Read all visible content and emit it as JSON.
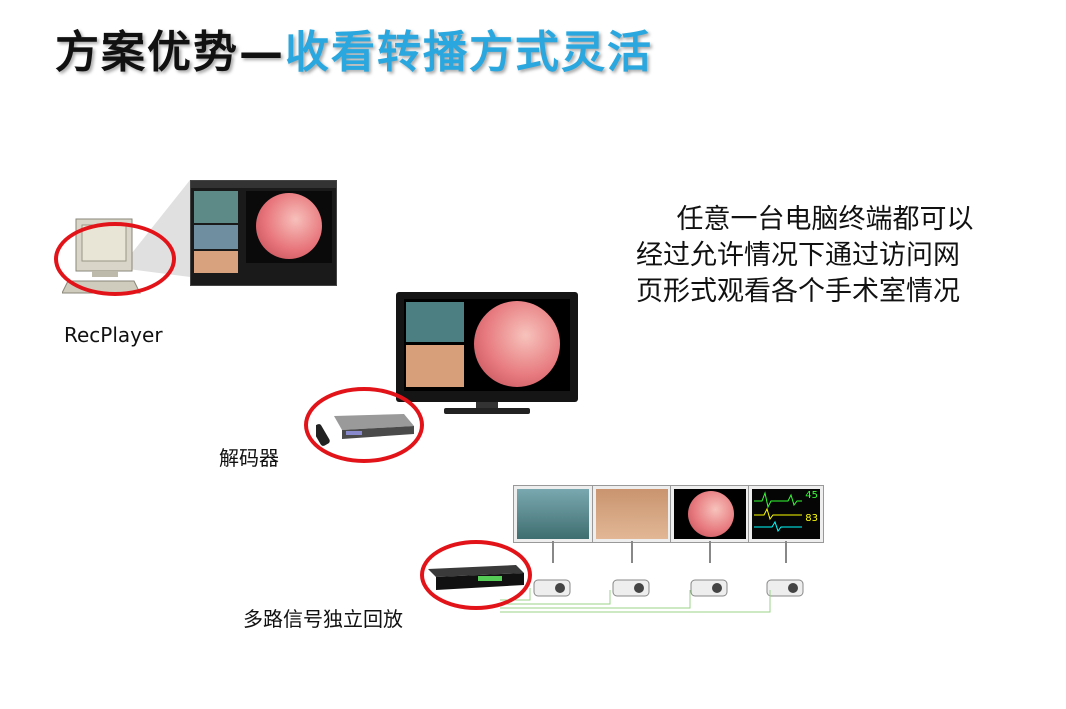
{
  "title": {
    "prefix": "方案优势—",
    "highlight": "收看转播方式灵活"
  },
  "labels": {
    "recplayer": "RecPlayer",
    "decoder": "解码器",
    "multi_playback": "多路信号独立回放"
  },
  "description": "任意一台电脑终端都可以经过允许情况下通过访问网页形式观看各个手术室情况",
  "monitor": {
    "value_top": "45",
    "value_mid": "83"
  },
  "colors": {
    "title_highlight": "#2aa7de",
    "ring": "#e2141a"
  }
}
